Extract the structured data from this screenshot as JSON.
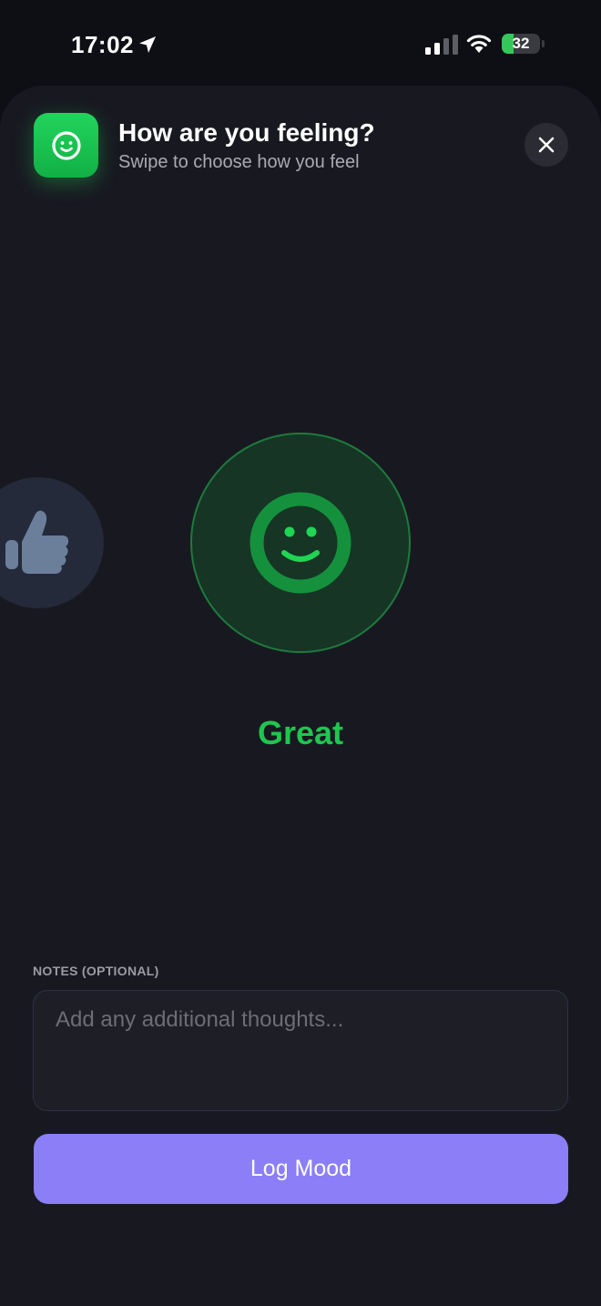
{
  "status_bar": {
    "time": "17:02",
    "battery_level": 32,
    "battery_text": "32",
    "battery_color": "#35c759"
  },
  "header": {
    "icon": "smiley-icon",
    "title": "How are you feeling?",
    "subtitle": "Swipe to choose how you feel",
    "close_icon": "close-icon"
  },
  "carousel": {
    "previous_icon": "thumbs-up-icon",
    "selected_icon": "smiley-icon",
    "selected_label": "Great",
    "selected_color": "#1fc64f"
  },
  "notes": {
    "label": "NOTES (OPTIONAL)",
    "placeholder": "Add any additional thoughts...",
    "value": ""
  },
  "actions": {
    "log_label": "Log Mood",
    "log_color": "#8b7ef7"
  }
}
